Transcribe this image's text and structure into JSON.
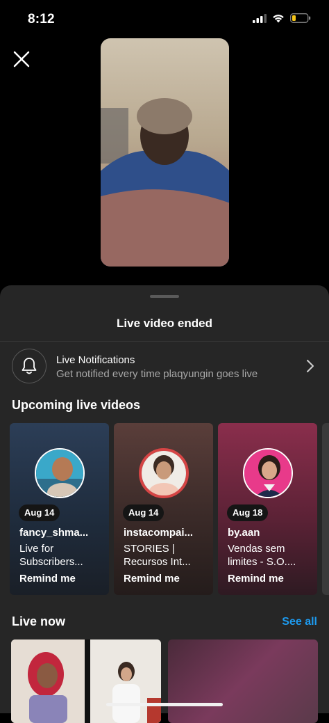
{
  "status_bar": {
    "time": "8:12"
  },
  "sheet": {
    "title": "Live video ended",
    "notifications": {
      "title": "Live Notifications",
      "subtitle": "Get notified every time plaqyungin goes live"
    },
    "upcoming": {
      "title": "Upcoming live videos",
      "cards": [
        {
          "date": "Aug 14",
          "username": "fancy_shma...",
          "desc1": "Live for",
          "desc2": "Subscribers...",
          "action": "Remind me"
        },
        {
          "date": "Aug 14",
          "username": "instacompai...",
          "desc1": "STORIES |",
          "desc2": "Recursos Int...",
          "action": "Remind me"
        },
        {
          "date": "Aug 18",
          "username": "by.aan",
          "desc1": "Vendas sem",
          "desc2": "limites - S.O....",
          "action": "Remind me"
        }
      ]
    },
    "live_now": {
      "title": "Live now",
      "see_all": "See all"
    }
  },
  "colors": {
    "accent": "#1d9bf0",
    "sheet_bg": "#262626",
    "muted_text": "#a8a8a8"
  },
  "icons": [
    "close-icon",
    "bell-icon",
    "chevron-right-icon",
    "signal-icon",
    "wifi-icon",
    "battery-icon"
  ]
}
